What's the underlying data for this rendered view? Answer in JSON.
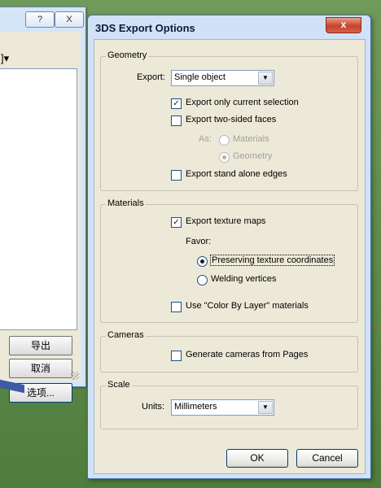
{
  "background_dialog": {
    "help_button": "?",
    "close_button": "X",
    "dropdown_fragment": "]▾",
    "buttons": {
      "export": "导出",
      "cancel": "取消",
      "options": "选项..."
    }
  },
  "dialog": {
    "title": "3DS Export Options",
    "close_label": "x",
    "geometry": {
      "legend": "Geometry",
      "export_label": "Export:",
      "export_value": "Single object",
      "only_current_selection": {
        "label": "Export only current selection",
        "checked": true
      },
      "two_sided_faces": {
        "label": "Export two-sided faces",
        "checked": false
      },
      "as_label": "As:",
      "as_options": [
        {
          "label": "Materials",
          "selected": false
        },
        {
          "label": "Geometry",
          "selected": true
        }
      ],
      "stand_alone_edges": {
        "label": "Export stand alone edges",
        "checked": false
      }
    },
    "materials": {
      "legend": "Materials",
      "export_texture_maps": {
        "label": "Export texture maps",
        "checked": true
      },
      "favor_label": "Favor:",
      "favor_options": [
        {
          "label": "Preserving texture coordinates",
          "selected": true
        },
        {
          "label": "Welding vertices",
          "selected": false
        }
      ],
      "color_by_layer": {
        "label": "Use \"Color By Layer\" materials",
        "checked": false
      }
    },
    "cameras": {
      "legend": "Cameras",
      "generate_cameras": {
        "label": "Generate cameras from Pages",
        "checked": false
      }
    },
    "scale": {
      "legend": "Scale",
      "units_label": "Units:",
      "units_value": "Millimeters"
    },
    "ok_label": "OK",
    "cancel_label": "Cancel"
  }
}
